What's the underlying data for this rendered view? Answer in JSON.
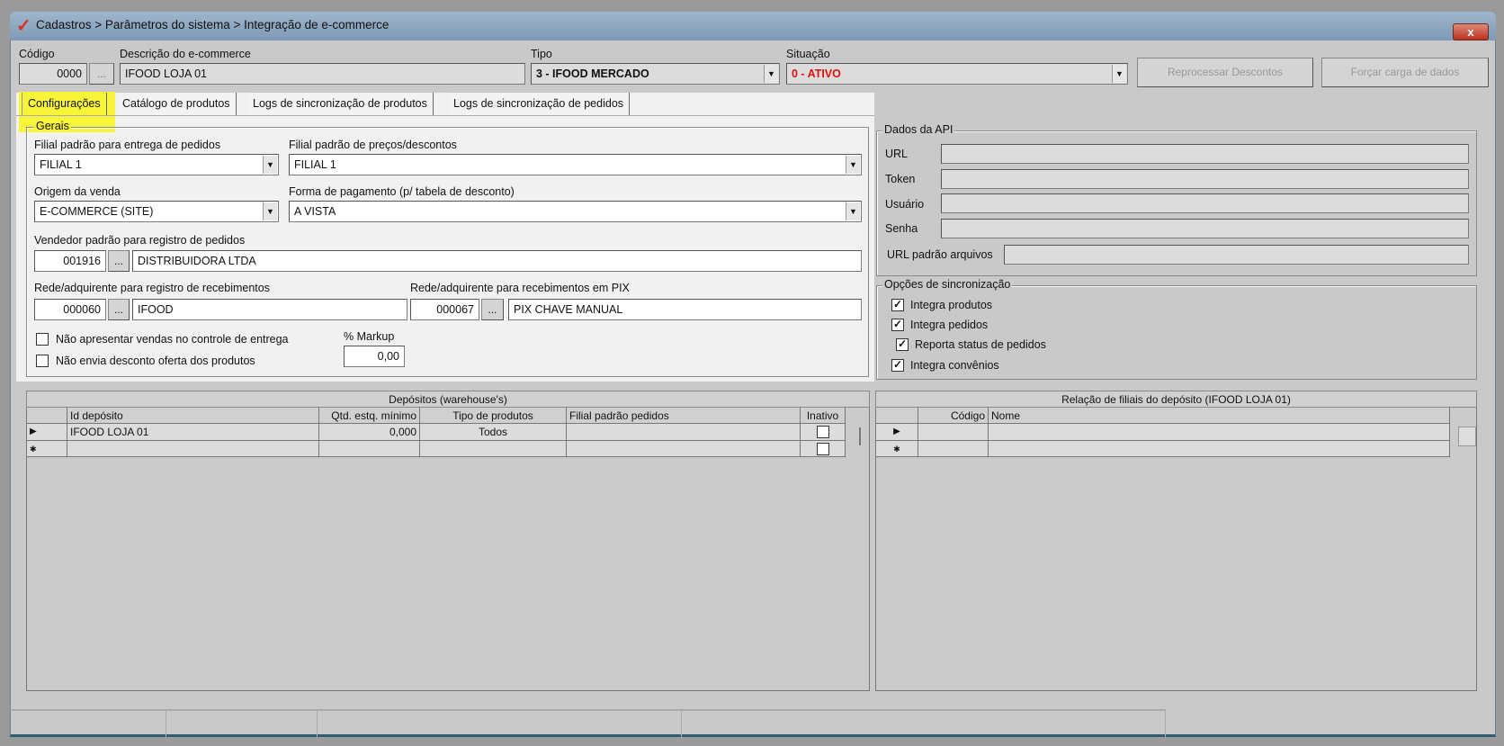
{
  "window": {
    "title": "Cadastros > Parâmetros do sistema >  Integração de e-commerce",
    "close_label": "x"
  },
  "header": {
    "codigo": {
      "label": "Código",
      "value": "0000",
      "lookup": "..."
    },
    "descricao": {
      "label": "Descrição do e-commerce",
      "value": "IFOOD LOJA 01"
    },
    "tipo": {
      "label": "Tipo",
      "value": "3 - IFOOD MERCADO"
    },
    "situacao": {
      "label": "Situação",
      "value": "0 - ATIVO",
      "color": "#e01010"
    },
    "reprocessar_label": "Reprocessar Descontos",
    "forcar_label": "Forçar carga de dados"
  },
  "tabs": [
    "Configurações",
    "Catálogo de produtos",
    "Logs de sincronização de produtos",
    "Logs de sincronização de pedidos"
  ],
  "gerais": {
    "title": "Gerais",
    "filial_entrega": {
      "label": "Filial padrão para entrega de pedidos",
      "value": "FILIAL 1"
    },
    "filial_precos": {
      "label": "Filial padrão de preços/descontos",
      "value": "FILIAL 1"
    },
    "origem": {
      "label": "Origem da venda",
      "value": "E-COMMERCE (SITE)"
    },
    "forma_pagamento": {
      "label": "Forma de pagamento (p/ tabela de desconto)",
      "value": "A VISTA"
    },
    "vendedor": {
      "label": "Vendedor padrão para registro de pedidos",
      "code": "001916",
      "name": "DISTRIBUIDORA LTDA"
    },
    "rede": {
      "label": "Rede/adquirente para registro de recebimentos",
      "code": "000060",
      "name": "IFOOD"
    },
    "rede_pix": {
      "label": "Rede/adquirente para recebimentos em PIX",
      "code": "000067",
      "name": "PIX CHAVE MANUAL"
    },
    "lookup": "...",
    "check1": {
      "label": "Não apresentar vendas no controle de entrega",
      "checked": false
    },
    "check2": {
      "label": "Não envia desconto oferta dos produtos",
      "checked": false
    },
    "markup": {
      "label": "% Markup",
      "value": "0,00"
    }
  },
  "api": {
    "title": "Dados da API",
    "url": "URL",
    "token": "Token",
    "usuario": "Usuário",
    "senha": "Senha",
    "url_arquivos": "URL padrão arquivos"
  },
  "sync": {
    "title": "Opções de sincronização",
    "items": [
      {
        "label": "Integra produtos",
        "checked": true
      },
      {
        "label": "Integra pedidos",
        "checked": true
      },
      {
        "label": "Reporta status de pedidos",
        "checked": true
      },
      {
        "label": "Integra convênios",
        "checked": true
      }
    ]
  },
  "depositos": {
    "title": "Depósitos (warehouse's)",
    "columns": [
      "Id depósito",
      "Qtd. estq. mínimo",
      "Tipo de produtos",
      "Filial padrão pedidos",
      "Inativo"
    ],
    "rows": [
      {
        "id": "IFOOD LOJA 01",
        "qtd": "0,000",
        "tipo": "Todos",
        "filial": "",
        "inativo": false
      }
    ]
  },
  "filiais": {
    "title": "Relação de filiais do depósito (IFOOD LOJA 01)",
    "columns": [
      "Código",
      "Nome"
    ]
  },
  "icons": {
    "row_indicator": "▶",
    "new_row": "✱",
    "check": "✓",
    "dropdown": "▼"
  }
}
